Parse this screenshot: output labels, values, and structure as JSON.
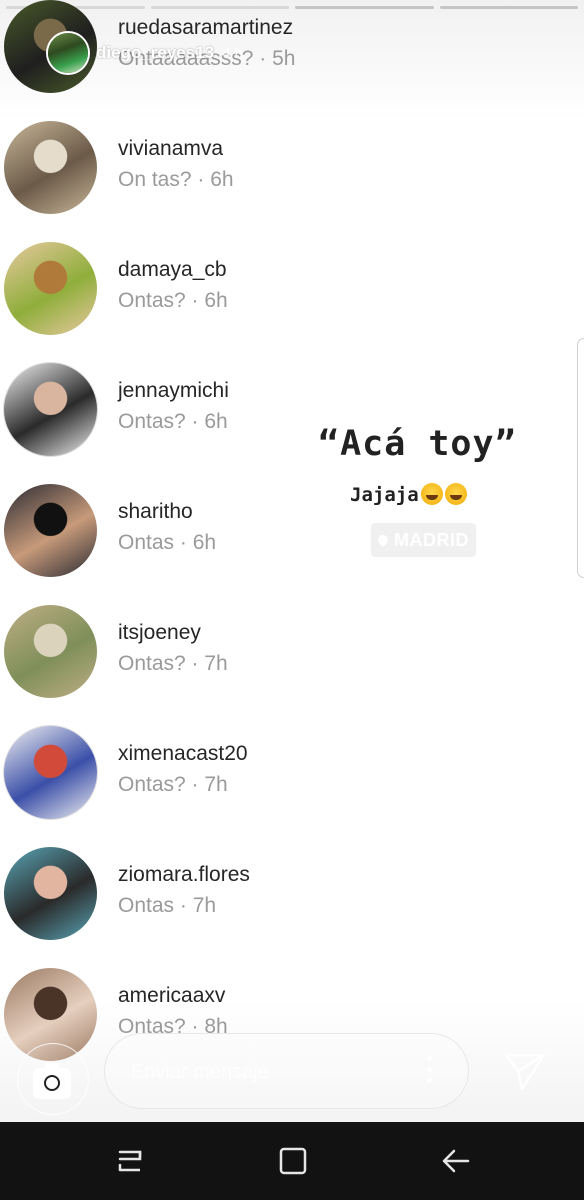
{
  "header": {
    "username": "diego_reyes13",
    "time": "4 h"
  },
  "viewers": [
    {
      "username": "ruedasaramartinez",
      "reply": "Ontaaaaasss? · 5h",
      "avatar_colors": [
        "#4a5a2a",
        "#1f1f1f",
        "#7a6a4a"
      ],
      "ring": false
    },
    {
      "username": "vivianamva",
      "reply": "On tas? · 6h",
      "avatar_colors": [
        "#c9b89a",
        "#6b5a48",
        "#e6dccc"
      ],
      "ring": false
    },
    {
      "username": "damaya_cb",
      "reply": "Ontas? · 6h",
      "avatar_colors": [
        "#e8c9a0",
        "#8fae3b",
        "#b07a3a"
      ],
      "ring": false
    },
    {
      "username": "jennaymichi",
      "reply": "Ontas? · 6h",
      "avatar_colors": [
        "#f4f4f4",
        "#2a2a2a",
        "#d9b5a0"
      ],
      "ring": true
    },
    {
      "username": "sharitho",
      "reply": "Ontas · 6h",
      "avatar_colors": [
        "#2a2a32",
        "#c79a7a",
        "#111111"
      ],
      "ring": false
    },
    {
      "username": "itsjoeney",
      "reply": "Ontas? · 7h",
      "avatar_colors": [
        "#bfae86",
        "#7f8f5a",
        "#dcd3bd"
      ],
      "ring": false
    },
    {
      "username": "ximenacast20",
      "reply": "Ontas? · 7h",
      "avatar_colors": [
        "#f2f2f2",
        "#3b4fa8",
        "#d24a3a"
      ],
      "ring": true
    },
    {
      "username": "ziomara.flores",
      "reply": "Ontas · 7h",
      "avatar_colors": [
        "#5aa7b8",
        "#2a2a2a",
        "#e2b5a0"
      ],
      "ring": false
    },
    {
      "username": "americaaxv",
      "reply": "Ontas? · 8h",
      "avatar_colors": [
        "#9a7a62",
        "#e6cfbf",
        "#4a3428"
      ],
      "ring": false
    }
  ],
  "caption": {
    "main": "“Acá toy”",
    "sub": "Jajaja"
  },
  "location": {
    "label": "MADRID"
  },
  "reply_bar": {
    "placeholder": "Enviar mensaje",
    "camera_icon": "camera-icon",
    "more_icon": "more-vertical-icon",
    "send_icon": "send-icon"
  },
  "navbar": {
    "recent_icon": "recent-apps-icon",
    "home_icon": "home-icon",
    "back_icon": "back-arrow-icon"
  },
  "colors": {
    "name_text": "#262626",
    "reply_text": "#9a9a9a",
    "navbar_bg": "#121212"
  }
}
